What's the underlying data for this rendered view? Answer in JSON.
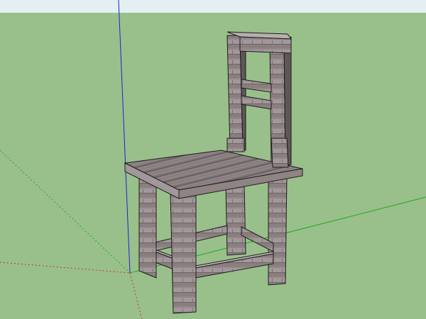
{
  "viewport": {
    "sky_color": "#e3eff0",
    "ground_color": "#99c08a"
  },
  "axes": {
    "blue_axis_color": "#2020d8",
    "green_axis_color": "#22a622",
    "red_axis_color": "#c83030"
  },
  "model": {
    "name": "chair",
    "wood_color": "#8f8384",
    "wood_dark_color": "#5e5657",
    "wood_light_color": "#b8aeae",
    "edge_color": "#1c1c1c"
  }
}
